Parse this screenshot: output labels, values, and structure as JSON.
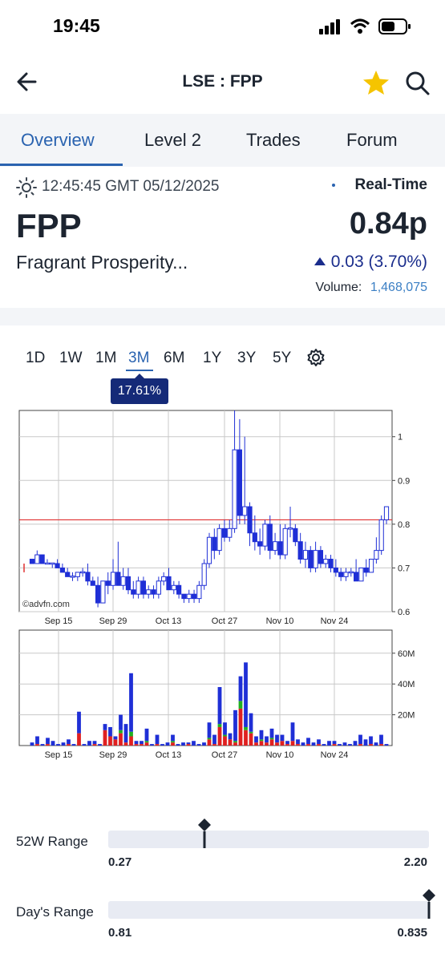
{
  "status_bar": {
    "time": "19:45"
  },
  "header": {
    "title": "LSE : FPP"
  },
  "tabs": [
    "Overview",
    "Level 2",
    "Trades",
    "Forum"
  ],
  "quote": {
    "timestamp": "12:45:45 GMT 05/12/2025",
    "realtime_label": "Real-Time",
    "symbol": "FPP",
    "price": "0.84p",
    "name": "Fragrant Prosperity...",
    "change": "0.03 (3.70%)",
    "volume_label": "Volume:",
    "volume": "1,468,075"
  },
  "ranges": [
    "1D",
    "1W",
    "1M",
    "3M",
    "6M",
    "1Y",
    "3Y",
    "5Y"
  ],
  "selected_range": "3M",
  "change_badge": "17.61%",
  "colors": {
    "accent": "#2a63b0",
    "badge": "#152a78",
    "up_candle": "#ffffff",
    "down_candle": "#1f2fd6",
    "ref_line": "#e03030"
  },
  "chart_data": [
    {
      "type": "candlestick",
      "watermark": "©advfn.com",
      "x_tick_labels": [
        "Sep 15",
        "Sep 29",
        "Oct 13",
        "Oct 27",
        "Nov 10",
        "Nov 24"
      ],
      "y_tick_labels": [
        "1",
        "0.9",
        "0.8",
        "0.7",
        "0.6"
      ],
      "ylim": [
        0.6,
        1.06
      ],
      "reference_line": 0.81,
      "grid": true,
      "candles": [
        [
          0.72,
          0.72,
          0.71,
          0.71
        ],
        [
          0.71,
          0.74,
          0.71,
          0.73
        ],
        [
          0.73,
          0.73,
          0.71,
          0.71
        ],
        [
          0.71,
          0.72,
          0.71,
          0.71
        ],
        [
          0.71,
          0.71,
          0.7,
          0.71
        ],
        [
          0.71,
          0.72,
          0.7,
          0.7
        ],
        [
          0.7,
          0.71,
          0.69,
          0.69
        ],
        [
          0.69,
          0.7,
          0.68,
          0.68
        ],
        [
          0.68,
          0.69,
          0.67,
          0.68
        ],
        [
          0.68,
          0.69,
          0.67,
          0.69
        ],
        [
          0.69,
          0.7,
          0.68,
          0.69
        ],
        [
          0.69,
          0.71,
          0.66,
          0.67
        ],
        [
          0.67,
          0.68,
          0.66,
          0.66
        ],
        [
          0.66,
          0.68,
          0.61,
          0.62
        ],
        [
          0.62,
          0.67,
          0.62,
          0.67
        ],
        [
          0.67,
          0.69,
          0.64,
          0.66
        ],
        [
          0.66,
          0.72,
          0.65,
          0.69
        ],
        [
          0.69,
          0.76,
          0.68,
          0.66
        ],
        [
          0.66,
          0.7,
          0.65,
          0.68
        ],
        [
          0.68,
          0.7,
          0.64,
          0.65
        ],
        [
          0.65,
          0.67,
          0.63,
          0.64
        ],
        [
          0.64,
          0.68,
          0.63,
          0.67
        ],
        [
          0.67,
          0.68,
          0.63,
          0.64
        ],
        [
          0.64,
          0.66,
          0.63,
          0.65
        ],
        [
          0.65,
          0.66,
          0.63,
          0.64
        ],
        [
          0.64,
          0.68,
          0.63,
          0.67
        ],
        [
          0.67,
          0.69,
          0.66,
          0.68
        ],
        [
          0.68,
          0.7,
          0.67,
          0.65
        ],
        [
          0.65,
          0.67,
          0.64,
          0.66
        ],
        [
          0.66,
          0.67,
          0.63,
          0.64
        ],
        [
          0.64,
          0.64,
          0.62,
          0.63
        ],
        [
          0.63,
          0.65,
          0.62,
          0.64
        ],
        [
          0.64,
          0.65,
          0.62,
          0.63
        ],
        [
          0.63,
          0.67,
          0.62,
          0.66
        ],
        [
          0.66,
          0.72,
          0.65,
          0.71
        ],
        [
          0.71,
          0.78,
          0.7,
          0.77
        ],
        [
          0.77,
          0.79,
          0.72,
          0.74
        ],
        [
          0.74,
          0.8,
          0.73,
          0.79
        ],
        [
          0.79,
          0.81,
          0.76,
          0.77
        ],
        [
          0.77,
          0.81,
          0.76,
          0.79
        ],
        [
          0.79,
          1.06,
          0.78,
          0.97
        ],
        [
          0.97,
          1.04,
          0.8,
          0.82
        ],
        [
          0.82,
          1.0,
          0.8,
          0.84
        ],
        [
          0.84,
          0.85,
          0.75,
          0.78
        ],
        [
          0.78,
          0.82,
          0.74,
          0.76
        ],
        [
          0.76,
          0.79,
          0.73,
          0.75
        ],
        [
          0.75,
          0.81,
          0.74,
          0.8
        ],
        [
          0.8,
          0.82,
          0.72,
          0.74
        ],
        [
          0.74,
          0.78,
          0.73,
          0.76
        ],
        [
          0.76,
          0.8,
          0.72,
          0.73
        ],
        [
          0.73,
          0.8,
          0.72,
          0.79
        ],
        [
          0.79,
          0.84,
          0.77,
          0.79
        ],
        [
          0.79,
          0.8,
          0.75,
          0.76
        ],
        [
          0.76,
          0.78,
          0.71,
          0.72
        ],
        [
          0.72,
          0.76,
          0.7,
          0.74
        ],
        [
          0.74,
          0.75,
          0.69,
          0.7
        ],
        [
          0.7,
          0.76,
          0.69,
          0.74
        ],
        [
          0.74,
          0.75,
          0.7,
          0.71
        ],
        [
          0.71,
          0.73,
          0.7,
          0.72
        ],
        [
          0.72,
          0.73,
          0.69,
          0.7
        ],
        [
          0.7,
          0.72,
          0.68,
          0.69
        ],
        [
          0.69,
          0.7,
          0.67,
          0.68
        ],
        [
          0.68,
          0.7,
          0.67,
          0.69
        ],
        [
          0.69,
          0.7,
          0.68,
          0.69
        ],
        [
          0.69,
          0.72,
          0.68,
          0.67
        ],
        [
          0.67,
          0.7,
          0.67,
          0.7
        ],
        [
          0.7,
          0.72,
          0.68,
          0.69
        ],
        [
          0.69,
          0.72,
          0.69,
          0.72
        ],
        [
          0.72,
          0.77,
          0.71,
          0.74
        ],
        [
          0.74,
          0.82,
          0.73,
          0.81
        ],
        [
          0.81,
          0.84,
          0.8,
          0.84
        ]
      ]
    },
    {
      "type": "bar",
      "x_tick_labels": [
        "Sep 15",
        "Sep 29",
        "Oct 13",
        "Oct 27",
        "Nov 10",
        "Nov 24"
      ],
      "y_tick_labels": [
        "60M",
        "40M",
        "20M"
      ],
      "ylim": [
        0,
        75
      ],
      "unit": "M",
      "series_colors": {
        "buy": "#e02020",
        "unknown": "#20b020",
        "sell": "#1f2fd6"
      },
      "volumes": [
        [
          0,
          0,
          2
        ],
        [
          1,
          0,
          5
        ],
        [
          0,
          0,
          1
        ],
        [
          1,
          0,
          4
        ],
        [
          0,
          0,
          3
        ],
        [
          0,
          0,
          1
        ],
        [
          0,
          0,
          2
        ],
        [
          1,
          0,
          3
        ],
        [
          0,
          0,
          1
        ],
        [
          8,
          0,
          14
        ],
        [
          0,
          0,
          1
        ],
        [
          0,
          0,
          3
        ],
        [
          1,
          0,
          2
        ],
        [
          0,
          0,
          1
        ],
        [
          10,
          0,
          4
        ],
        [
          6,
          0,
          6
        ],
        [
          4,
          0,
          2
        ],
        [
          8,
          2,
          10
        ],
        [
          2,
          0,
          12
        ],
        [
          6,
          3,
          38
        ],
        [
          1,
          0,
          2
        ],
        [
          1,
          0,
          2
        ],
        [
          2,
          1,
          8
        ],
        [
          0,
          0,
          1
        ],
        [
          1,
          0,
          6
        ],
        [
          0,
          0,
          1
        ],
        [
          0,
          0,
          2
        ],
        [
          2,
          1,
          4
        ],
        [
          0,
          0,
          1
        ],
        [
          0,
          0,
          2
        ],
        [
          1,
          0,
          1
        ],
        [
          0,
          0,
          3
        ],
        [
          0,
          0,
          1
        ],
        [
          0,
          0,
          2
        ],
        [
          4,
          1,
          10
        ],
        [
          1,
          0,
          6
        ],
        [
          12,
          2,
          24
        ],
        [
          6,
          1,
          8
        ],
        [
          4,
          0,
          4
        ],
        [
          2,
          1,
          20
        ],
        [
          24,
          5,
          16
        ],
        [
          10,
          2,
          42
        ],
        [
          8,
          1,
          12
        ],
        [
          2,
          0,
          4
        ],
        [
          3,
          1,
          6
        ],
        [
          2,
          0,
          4
        ],
        [
          4,
          1,
          6
        ],
        [
          2,
          0,
          5
        ],
        [
          3,
          0,
          4
        ],
        [
          1,
          0,
          2
        ],
        [
          3,
          0,
          12
        ],
        [
          1,
          0,
          3
        ],
        [
          0,
          0,
          2
        ],
        [
          1,
          0,
          4
        ],
        [
          0,
          0,
          2
        ],
        [
          1,
          0,
          3
        ],
        [
          0,
          0,
          1
        ],
        [
          0,
          0,
          3
        ],
        [
          1,
          0,
          2
        ],
        [
          0,
          0,
          1
        ],
        [
          0,
          0,
          2
        ],
        [
          0,
          0,
          1
        ],
        [
          0,
          0,
          3
        ],
        [
          1,
          0,
          6
        ],
        [
          0,
          0,
          4
        ],
        [
          1,
          0,
          5
        ],
        [
          0,
          0,
          2
        ],
        [
          1,
          0,
          6
        ],
        [
          0,
          0,
          1
        ]
      ]
    }
  ],
  "ranges_52w": {
    "label": "52W Range",
    "low": "0.27",
    "high": "2.20",
    "position": 0.3
  },
  "day_range": {
    "label": "Day's Range",
    "low": "0.81",
    "high": "0.835",
    "position": 1.0
  }
}
